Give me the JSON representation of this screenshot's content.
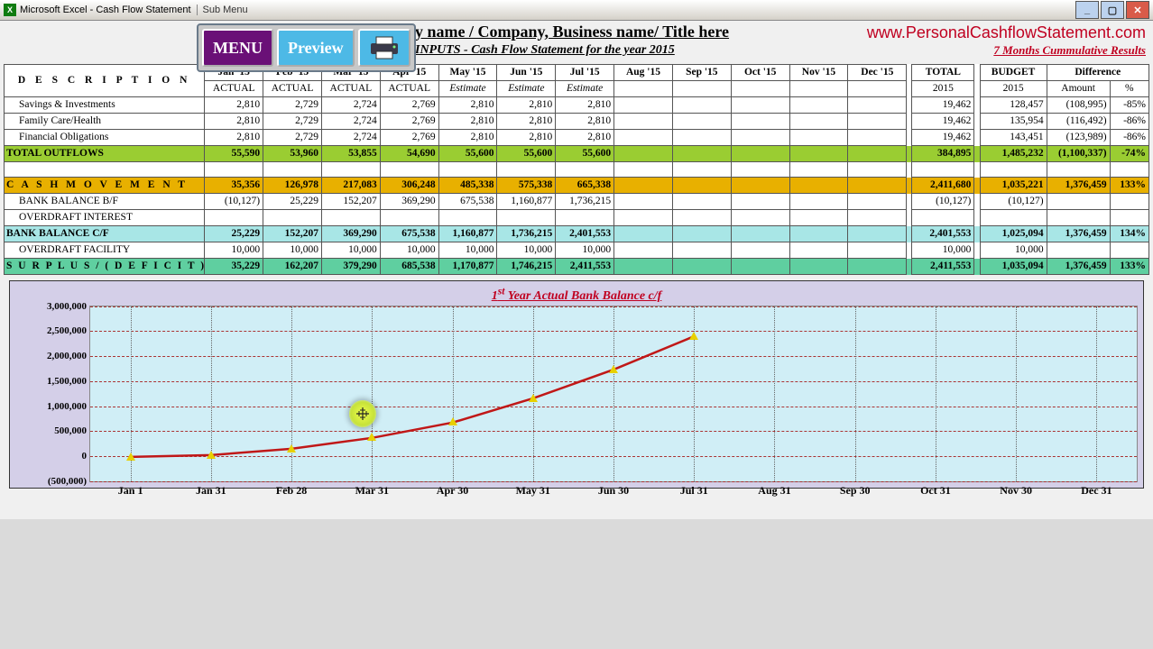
{
  "window": {
    "app_title": "Microsoft Excel - Cash Flow Statement",
    "submenu": "Sub Menu"
  },
  "toolbar": {
    "menu": "MENU",
    "preview": "Preview"
  },
  "header": {
    "title": "y name / Company, Business name/ Title  here",
    "subtitle": "INPUTS - Cash Flow Statement for the year 2015",
    "site_url": "www.PersonalCashflowStatement.com",
    "cummulative_note": "7 Months Cummulative Results"
  },
  "columns": {
    "description": "D E S C R I P T I O N",
    "months": [
      "Jan '15",
      "Feb '15",
      "Mar '15",
      "Apr '15",
      "May '15",
      "Jun '15",
      "Jul '15",
      "Aug '15",
      "Sep '15",
      "Oct '15",
      "Nov '15",
      "Dec '15"
    ],
    "month_sub": [
      "ACTUAL",
      "ACTUAL",
      "ACTUAL",
      "ACTUAL",
      "Estimate",
      "Estimate",
      "Estimate",
      "",
      "",
      "",
      "",
      ""
    ],
    "total": "TOTAL",
    "total_sub": "2015",
    "budget": "BUDGET",
    "budget_sub": "2015",
    "difference": "Difference",
    "diff_amount": "Amount",
    "diff_pct": "%"
  },
  "rows": [
    {
      "label": "Savings & Investments",
      "cls": "",
      "vals": [
        "2,810",
        "2,729",
        "2,724",
        "2,769",
        "2,810",
        "2,810",
        "2,810",
        "",
        "",
        "",
        "",
        ""
      ],
      "total": "19,462",
      "budget": "128,457",
      "diff": "(108,995)",
      "pct": "-85%"
    },
    {
      "label": "Family Care/Health",
      "cls": "",
      "vals": [
        "2,810",
        "2,729",
        "2,724",
        "2,769",
        "2,810",
        "2,810",
        "2,810",
        "",
        "",
        "",
        "",
        ""
      ],
      "total": "19,462",
      "budget": "135,954",
      "diff": "(116,492)",
      "pct": "-86%"
    },
    {
      "label": "Financial Obligations",
      "cls": "",
      "vals": [
        "2,810",
        "2,729",
        "2,724",
        "2,769",
        "2,810",
        "2,810",
        "2,810",
        "",
        "",
        "",
        "",
        ""
      ],
      "total": "19,462",
      "budget": "143,451",
      "diff": "(123,989)",
      "pct": "-86%"
    },
    {
      "label": "TOTAL OUTFLOWS",
      "cls": "ylw",
      "vals": [
        "55,590",
        "53,960",
        "53,855",
        "54,690",
        "55,600",
        "55,600",
        "55,600",
        "",
        "",
        "",
        "",
        ""
      ],
      "total": "384,895",
      "budget": "1,485,232",
      "diff": "(1,100,337)",
      "pct": "-74%"
    },
    {
      "label": "",
      "cls": "blank",
      "vals": [
        "",
        "",
        "",
        "",
        "",
        "",
        "",
        "",
        "",
        "",
        "",
        ""
      ],
      "total": "",
      "budget": "",
      "diff": "",
      "pct": ""
    },
    {
      "label": "C A S H   M O V E M E N T",
      "cls": "gold",
      "vals": [
        "35,356",
        "126,978",
        "217,083",
        "306,248",
        "485,338",
        "575,338",
        "665,338",
        "",
        "",
        "",
        "",
        ""
      ],
      "total": "2,411,680",
      "budget": "1,035,221",
      "diff": "1,376,459",
      "pct": "133%"
    },
    {
      "label": "BANK BALANCE  B/F",
      "cls": "",
      "vals": [
        "(10,127)",
        "25,229",
        "152,207",
        "369,290",
        "675,538",
        "1,160,877",
        "1,736,215",
        "",
        "",
        "",
        "",
        ""
      ],
      "total": "(10,127)",
      "budget": "(10,127)",
      "diff": "",
      "pct": ""
    },
    {
      "label": "OVERDRAFT INTEREST",
      "cls": "",
      "vals": [
        "",
        "",
        "",
        "",
        "",
        "",
        "",
        "",
        "",
        "",
        "",
        ""
      ],
      "total": "",
      "budget": "",
      "diff": "",
      "pct": ""
    },
    {
      "label": "BANK BALANCE  C/F",
      "cls": "cyan",
      "vals": [
        "25,229",
        "152,207",
        "369,290",
        "675,538",
        "1,160,877",
        "1,736,215",
        "2,401,553",
        "",
        "",
        "",
        "",
        ""
      ],
      "total": "2,401,553",
      "budget": "1,025,094",
      "diff": "1,376,459",
      "pct": "134%"
    },
    {
      "label": "OVERDRAFT FACILITY",
      "cls": "",
      "vals": [
        "10,000",
        "10,000",
        "10,000",
        "10,000",
        "10,000",
        "10,000",
        "10,000",
        "",
        "",
        "",
        "",
        ""
      ],
      "total": "10,000",
      "budget": "10,000",
      "diff": "",
      "pct": ""
    },
    {
      "label": "S U R P L U S  /  ( D E F I C I T )",
      "cls": "grn",
      "vals": [
        "35,229",
        "162,207",
        "379,290",
        "685,538",
        "1,170,877",
        "1,746,215",
        "2,411,553",
        "",
        "",
        "",
        "",
        ""
      ],
      "total": "2,411,553",
      "budget": "1,035,094",
      "diff": "1,376,459",
      "pct": "133%"
    }
  ],
  "chart_data": {
    "type": "line",
    "title": "1st Year Actual Bank Balance c/f",
    "xlabels": [
      "Jan 1",
      "Jan 31",
      "Feb 28",
      "Mar 31",
      "Apr 30",
      "May 31",
      "Jun 30",
      "Jul 31",
      "Aug 31",
      "Sep 30",
      "Oct 31",
      "Nov 30",
      "Dec 31"
    ],
    "yticks": [
      -500000,
      0,
      500000,
      1000000,
      1500000,
      2000000,
      2500000,
      3000000
    ],
    "yticklabels": [
      "(500,000)",
      "0",
      "500,000",
      "1,000,000",
      "1,500,000",
      "2,000,000",
      "2,500,000",
      "3,000,000"
    ],
    "ylim": [
      -500000,
      3000000
    ],
    "series": [
      {
        "name": "Bank Balance c/f",
        "color": "#c01818",
        "x": [
          "Jan 1",
          "Jan 31",
          "Feb 28",
          "Mar 31",
          "Apr 30",
          "May 31",
          "Jun 30",
          "Jul 31"
        ],
        "y": [
          -10127,
          25229,
          152207,
          369290,
          675538,
          1160877,
          1736215,
          2401553
        ]
      }
    ],
    "highlight_point_index": 3
  }
}
